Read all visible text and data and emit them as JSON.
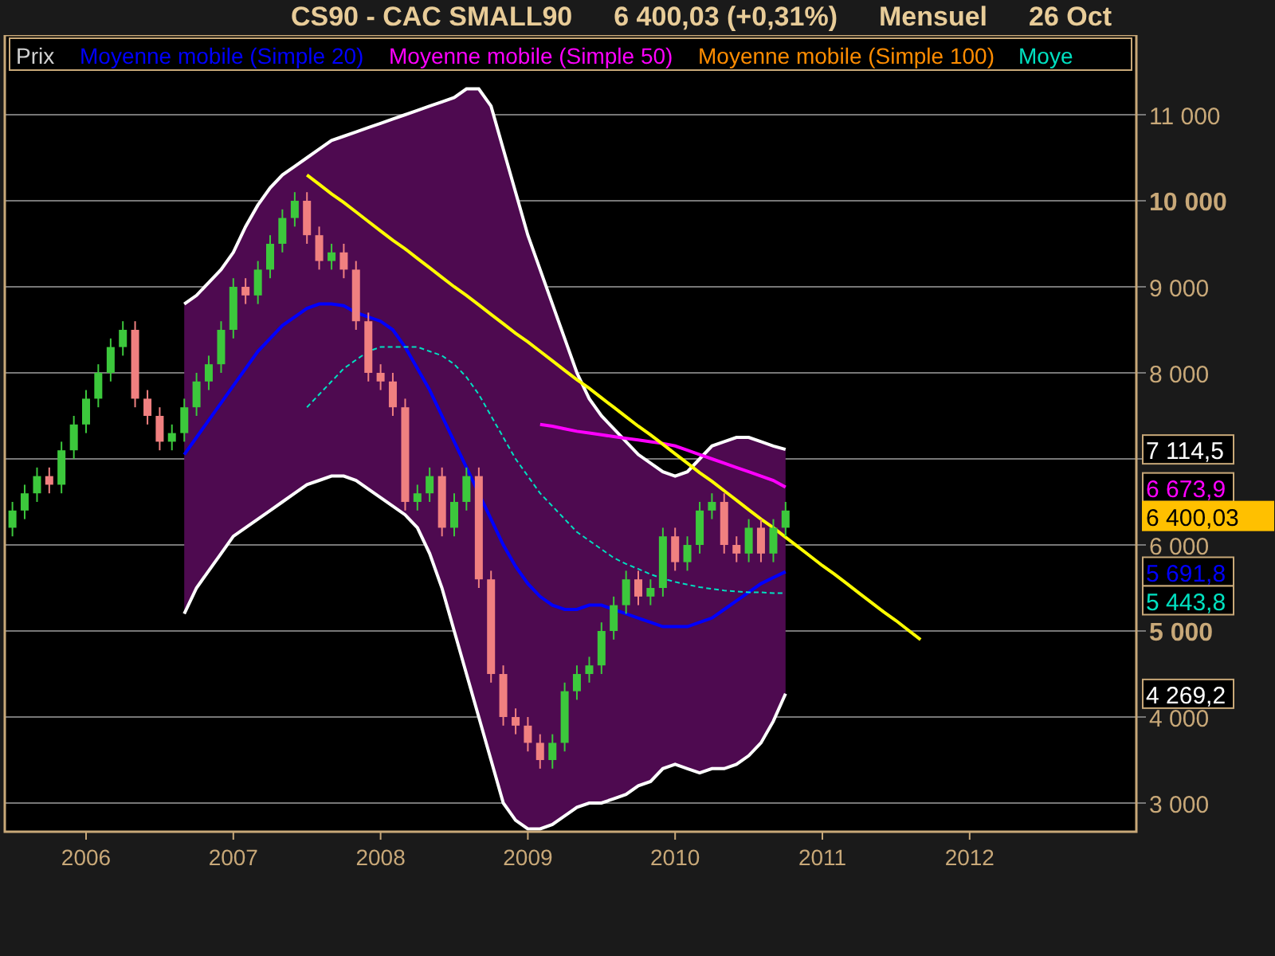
{
  "header": {
    "parts": [
      "CS90 - CAC SMALL90",
      "6 400,03 (+0,31%)",
      "Mensuel",
      "26 Oct"
    ]
  },
  "chart": {
    "legend": [
      {
        "text": "Prix",
        "color": "#d0d0d0"
      },
      {
        "text": "Moyenne mobile (Simple 20)",
        "color": "#0000ff"
      },
      {
        "text": "Moyenne mobile (Simple 50)",
        "color": "#ff00ff"
      },
      {
        "text": "Moyenne mobile (Simple 100)",
        "color": "#ff8c00"
      },
      {
        "text": "Moye",
        "color": "#00e0c0"
      }
    ],
    "chart_data": {
      "type": "candlestick",
      "grid": true,
      "x": [
        2005.5,
        2005.583,
        2005.667,
        2005.75,
        2005.833,
        2005.917,
        2006,
        2006.083,
        2006.167,
        2006.25,
        2006.333,
        2006.417,
        2006.5,
        2006.583,
        2006.667,
        2006.75,
        2006.833,
        2006.917,
        2007,
        2007.083,
        2007.167,
        2007.25,
        2007.333,
        2007.417,
        2007.5,
        2007.583,
        2007.667,
        2007.75,
        2007.833,
        2007.917,
        2008,
        2008.083,
        2008.167,
        2008.25,
        2008.333,
        2008.417,
        2008.5,
        2008.583,
        2008.667,
        2008.75,
        2008.833,
        2008.917,
        2009,
        2009.083,
        2009.167,
        2009.25,
        2009.333,
        2009.417,
        2009.5,
        2009.583,
        2009.667,
        2009.75,
        2009.833,
        2009.917,
        2010,
        2010.083,
        2010.167,
        2010.25,
        2010.333,
        2010.417,
        2010.5,
        2010.583,
        2010.667,
        2010.75
      ],
      "ohlc": [
        [
          6200,
          6500,
          6100,
          6400
        ],
        [
          6400,
          6700,
          6300,
          6600
        ],
        [
          6600,
          6900,
          6500,
          6800
        ],
        [
          6800,
          6900,
          6600,
          6700
        ],
        [
          6700,
          7200,
          6600,
          7100
        ],
        [
          7100,
          7500,
          7000,
          7400
        ],
        [
          7400,
          7800,
          7300,
          7700
        ],
        [
          7700,
          8100,
          7600,
          8000
        ],
        [
          8000,
          8400,
          7900,
          8300
        ],
        [
          8300,
          8600,
          8200,
          8500
        ],
        [
          8500,
          8600,
          7600,
          7700
        ],
        [
          7700,
          7800,
          7400,
          7500
        ],
        [
          7500,
          7600,
          7100,
          7200
        ],
        [
          7200,
          7400,
          7100,
          7300
        ],
        [
          7300,
          7700,
          7200,
          7600
        ],
        [
          7600,
          8000,
          7500,
          7900
        ],
        [
          7900,
          8200,
          7800,
          8100
        ],
        [
          8100,
          8600,
          8000,
          8500
        ],
        [
          8500,
          9100,
          8400,
          9000
        ],
        [
          9000,
          9100,
          8800,
          8900
        ],
        [
          8900,
          9300,
          8800,
          9200
        ],
        [
          9200,
          9600,
          9100,
          9500
        ],
        [
          9500,
          9900,
          9400,
          9800
        ],
        [
          9800,
          10100,
          9700,
          10000
        ],
        [
          10000,
          10100,
          9500,
          9600
        ],
        [
          9600,
          9700,
          9200,
          9300
        ],
        [
          9300,
          9500,
          9200,
          9400
        ],
        [
          9400,
          9500,
          9100,
          9200
        ],
        [
          9200,
          9300,
          8500,
          8600
        ],
        [
          8600,
          8700,
          7900,
          8000
        ],
        [
          8000,
          8100,
          7800,
          7900
        ],
        [
          7900,
          8000,
          7500,
          7600
        ],
        [
          7600,
          7700,
          6400,
          6500
        ],
        [
          6500,
          6700,
          6400,
          6600
        ],
        [
          6600,
          6900,
          6500,
          6800
        ],
        [
          6800,
          6900,
          6100,
          6200
        ],
        [
          6200,
          6600,
          6100,
          6500
        ],
        [
          6500,
          6900,
          6400,
          6800
        ],
        [
          6800,
          6900,
          5500,
          5600
        ],
        [
          5600,
          5700,
          4400,
          4500
        ],
        [
          4500,
          4600,
          3900,
          4000
        ],
        [
          4000,
          4100,
          3800,
          3900
        ],
        [
          3900,
          4000,
          3600,
          3700
        ],
        [
          3700,
          3800,
          3400,
          3500
        ],
        [
          3500,
          3800,
          3400,
          3700
        ],
        [
          3700,
          4400,
          3600,
          4300
        ],
        [
          4300,
          4600,
          4200,
          4500
        ],
        [
          4500,
          4700,
          4400,
          4600
        ],
        [
          4600,
          5100,
          4500,
          5000
        ],
        [
          5000,
          5400,
          4900,
          5300
        ],
        [
          5300,
          5700,
          5200,
          5600
        ],
        [
          5600,
          5700,
          5300,
          5400
        ],
        [
          5400,
          5600,
          5300,
          5500
        ],
        [
          5500,
          6200,
          5400,
          6100
        ],
        [
          6100,
          6200,
          5700,
          5800
        ],
        [
          5800,
          6100,
          5700,
          6000
        ],
        [
          6000,
          6500,
          5900,
          6400
        ],
        [
          6400,
          6600,
          6300,
          6500
        ],
        [
          6500,
          6600,
          5900,
          6000
        ],
        [
          6000,
          6100,
          5800,
          5900
        ],
        [
          5900,
          6300,
          5800,
          6200
        ],
        [
          6200,
          6300,
          5800,
          5900
        ],
        [
          5900,
          6300,
          5800,
          6200
        ],
        [
          6200,
          6500,
          6100,
          6400
        ]
      ],
      "xlim": [
        2005.448,
        2013.132
      ],
      "ylim": [
        2667,
        11926
      ],
      "xticks": [
        {
          "value": 2006,
          "label": "2006"
        },
        {
          "value": 2007,
          "label": "2007"
        },
        {
          "value": 2008,
          "label": "2008"
        },
        {
          "value": 2009,
          "label": "2009"
        },
        {
          "value": 2010,
          "label": "2010"
        },
        {
          "value": 2011,
          "label": "2011"
        },
        {
          "value": 2012,
          "label": "2012"
        }
      ],
      "yticks": [
        {
          "value": 3000,
          "label": "3 000"
        },
        {
          "value": 4000,
          "label": "4 000"
        },
        {
          "value": 5000,
          "label": "5 000"
        },
        {
          "value": 6000,
          "label": "6 000"
        },
        {
          "value": 8000,
          "label": "8 000"
        },
        {
          "value": 9000,
          "label": "9 000"
        },
        {
          "value": 10000,
          "label": "10 000"
        },
        {
          "value": 11000,
          "label": "11 000"
        }
      ],
      "annotations": [
        "7 114,5",
        "6 673,9",
        "6 400,03",
        "5 691,8",
        "5 443,8",
        "4 269,2"
      ]
    },
    "overlay": {
      "band": true,
      "chart_data": {
        "type": "line",
        "xlim": [
          2005.448,
          2013.132
        ],
        "ylim": [
          2667,
          11926
        ],
        "x": [
          2006.667,
          2006.75,
          2006.833,
          2006.917,
          2007,
          2007.083,
          2007.167,
          2007.25,
          2007.333,
          2007.417,
          2007.5,
          2007.583,
          2007.667,
          2007.75,
          2007.833,
          2007.917,
          2008,
          2008.083,
          2008.167,
          2008.25,
          2008.333,
          2008.417,
          2008.5,
          2008.583,
          2008.667,
          2008.75,
          2008.833,
          2008.917,
          2009,
          2009.083,
          2009.167,
          2009.25,
          2009.333,
          2009.417,
          2009.5,
          2009.583,
          2009.667,
          2009.75,
          2009.833,
          2009.917,
          2010,
          2010.083,
          2010.167,
          2010.25,
          2010.333,
          2010.417,
          2010.5,
          2010.583,
          2010.667,
          2010.75,
          2010.833,
          2010.917,
          2011,
          2011.083,
          2011.167,
          2011.25,
          2011.333,
          2011.417,
          2011.5,
          2011.583,
          2011.667
        ],
        "series": [
          {
            "color": "#ffffff",
            "values": [
              8800,
              8900,
              9050,
              9200,
              9400,
              9700,
              9950,
              10150,
              10300,
              10400,
              10500,
              10600,
              10700,
              10750,
              10800,
              10850,
              10900,
              10950,
              11000,
              11050,
              11100,
              11150,
              11200,
              11300,
              11300,
              11100,
              10600,
              10100,
              9600,
              9200,
              8800,
              8400,
              8000,
              7700,
              7500,
              7350,
              7200,
              7050,
              6950,
              6850,
              6800,
              6850,
              7000,
              7150,
              7200,
              7250,
              7250,
              7200,
              7150,
              7110,
              null,
              null,
              null,
              null,
              null,
              null,
              null,
              null,
              null,
              null,
              null
            ]
          },
          {
            "color": "#ffffff",
            "values": [
              5200,
              5500,
              5700,
              5900,
              6100,
              6200,
              6300,
              6400,
              6500,
              6600,
              6700,
              6750,
              6800,
              6800,
              6750,
              6650,
              6550,
              6450,
              6350,
              6200,
              5900,
              5500,
              5000,
              4500,
              4000,
              3500,
              3000,
              2800,
              2700,
              2700,
              2750,
              2850,
              2950,
              3000,
              3000,
              3050,
              3100,
              3200,
              3250,
              3400,
              3450,
              3400,
              3350,
              3400,
              3400,
              3450,
              3550,
              3700,
              3950,
              4270,
              null,
              null,
              null,
              null,
              null,
              null,
              null,
              null,
              null,
              null,
              null
            ]
          },
          {
            "color": "#0000ff",
            "values": [
              7050,
              7250,
              7450,
              7650,
              7850,
              8050,
              8250,
              8400,
              8550,
              8650,
              8750,
              8800,
              8800,
              8780,
              8700,
              8650,
              8600,
              8500,
              8300,
              8050,
              7800,
              7500,
              7200,
              6900,
              6600,
              6300,
              6000,
              5750,
              5550,
              5400,
              5300,
              5250,
              5250,
              5300,
              5300,
              5250,
              5200,
              5150,
              5100,
              5050,
              5050,
              5050,
              5100,
              5150,
              5250,
              5350,
              5450,
              5550,
              5620,
              5690,
              null,
              null,
              null,
              null,
              null,
              null,
              null,
              null,
              null,
              null,
              null
            ]
          },
          {
            "color": "#ff00ff",
            "values": [
              null,
              null,
              null,
              null,
              null,
              null,
              null,
              null,
              null,
              null,
              null,
              null,
              null,
              null,
              null,
              null,
              null,
              null,
              null,
              null,
              null,
              null,
              null,
              null,
              null,
              null,
              null,
              null,
              null,
              7400,
              7380,
              7350,
              7320,
              7300,
              7280,
              7260,
              7240,
              7220,
              7200,
              7180,
              7150,
              7100,
              7050,
              7000,
              6950,
              6900,
              6850,
              6800,
              6750,
              6670,
              null,
              null,
              null,
              null,
              null,
              null,
              null,
              null,
              null,
              null,
              null
            ]
          },
          {
            "color": "#00e0c0",
            "line_style": "dashed",
            "values": [
              null,
              null,
              null,
              null,
              null,
              null,
              null,
              null,
              null,
              null,
              7600,
              7750,
              7900,
              8050,
              8150,
              8250,
              8300,
              8300,
              8300,
              8300,
              8250,
              8200,
              8100,
              7950,
              7750,
              7500,
              7250,
              7000,
              6800,
              6600,
              6450,
              6300,
              6150,
              6050,
              5950,
              5850,
              5780,
              5720,
              5660,
              5610,
              5570,
              5540,
              5510,
              5490,
              5470,
              5460,
              5450,
              5450,
              5440,
              5440,
              null,
              null,
              null,
              null,
              null,
              null,
              null,
              null,
              null,
              null,
              null
            ]
          },
          {
            "color": "#ffff00",
            "values": [
              null,
              null,
              null,
              null,
              null,
              null,
              null,
              null,
              null,
              null,
              10300,
              10190,
              10080,
              9980,
              9870,
              9760,
              9650,
              9540,
              9440,
              9330,
              9220,
              9110,
              9000,
              8900,
              8790,
              8680,
              8570,
              8460,
              8360,
              8250,
              8140,
              8030,
              7920,
              7820,
              7710,
              7600,
              7490,
              7380,
              7280,
              7170,
              7060,
              6950,
              6840,
              6740,
              6630,
              6520,
              6410,
              6300,
              6200,
              6090,
              5980,
              5870,
              5760,
              5660,
              5550,
              5440,
              5330,
              5220,
              5120,
              5010,
              4900
            ]
          }
        ]
      }
    }
  }
}
